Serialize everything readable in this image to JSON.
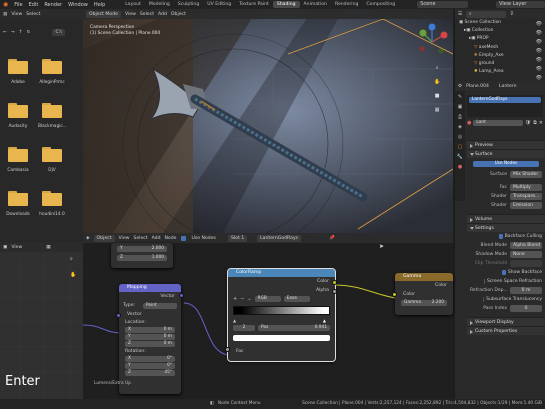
{
  "topbar": {
    "menus": [
      "File",
      "Edit",
      "Render",
      "Window",
      "Help"
    ],
    "workspaces": [
      "Layout",
      "Modeling",
      "Sculpting",
      "UV Editing",
      "Texture Paint",
      "Shading",
      "Animation",
      "Rendering",
      "Compositing"
    ],
    "active_workspace": "Shading",
    "scene": "Scene",
    "view_layer": "View Layer"
  },
  "file_browser": {
    "header": [
      "View",
      "Select"
    ],
    "path": "C:\\",
    "folders": [
      "Adobe",
      "AlleginPrmc",
      "Audacity",
      "Blackmagic...",
      "Cambasia",
      "DjV",
      "Downloads",
      "houdini14.0"
    ]
  },
  "viewport": {
    "mode": "Object Mode",
    "menus": [
      "View",
      "Select",
      "Add",
      "Object"
    ],
    "orientation_label": "Orientation:",
    "orientation": "Default",
    "drag_label": "Drag",
    "select_box": "Select Box",
    "transform": "Local",
    "overlay_title": "Camera Perspective",
    "overlay_sub": "(1) Scene Collection | Plane.004"
  },
  "outliner": {
    "title": "Scene Collection",
    "rows": [
      "Collection",
      "PROP",
      "axeMesh",
      "Empty_Axe",
      "ground",
      "Lamp_Area"
    ]
  },
  "properties": {
    "object_name": "Plane.004",
    "tab2": "Lantern",
    "material_slot": "LanternGodRays",
    "material_name": "Lant",
    "sections": {
      "preview": "Preview",
      "surface": "Surface",
      "volume": "Volume",
      "settings": "Settings",
      "viewport_display": "Viewport Display",
      "custom_properties": "Custom Properties"
    },
    "use_nodes": "Use Nodes",
    "surface_rows": [
      {
        "k": "Surface",
        "v": "Mix Shader"
      },
      {
        "k": "Fac",
        "v": "Multiply"
      },
      {
        "k": "Shader",
        "v": "Transpare..."
      },
      {
        "k": "Shader",
        "v": "Emission"
      }
    ],
    "settings_rows": [
      {
        "k": "",
        "v": "Backface Culling",
        "check": true
      },
      {
        "k": "Blend Mode",
        "v": "Alpha Blend"
      },
      {
        "k": "Shadow Mode",
        "v": "None"
      },
      {
        "k": "Clip Threshold",
        "v": ""
      },
      {
        "k": "",
        "v": "Show Backface",
        "check": true
      },
      {
        "k": "",
        "v": "Screen Space Refraction",
        "check": false
      },
      {
        "k": "Refraction Dep...",
        "v": "0 m"
      },
      {
        "k": "",
        "v": "Subsurface Translucency",
        "check": false
      },
      {
        "k": "Pass Index",
        "v": "0"
      }
    ]
  },
  "node_editor": {
    "object": "Object",
    "menus": [
      "View",
      "Select",
      "Add",
      "Node"
    ],
    "use_nodes": "Use Nodes",
    "slot": "Slot 1",
    "material": "LanternGodRays",
    "top_fields": [
      {
        "k": "Y",
        "v": "2.000"
      },
      {
        "k": "Z",
        "v": "1.000"
      }
    ],
    "mapping": {
      "title": "Mapping",
      "out": "Vector",
      "type_label": "Type:",
      "type": "Point",
      "in": "Vector",
      "location_label": "Location:",
      "location": [
        {
          "k": "X",
          "v": "0 m"
        },
        {
          "k": "Y",
          "v": "0 m"
        },
        {
          "k": "Z",
          "v": "0 m"
        }
      ],
      "rotation_label": "Rotation:",
      "rotation": [
        {
          "k": "X",
          "v": "0°"
        },
        {
          "k": "Y",
          "v": "0°"
        },
        {
          "k": "Z",
          "v": "45°"
        }
      ]
    },
    "colorramp": {
      "title": "ColorRamp",
      "out_color": "Color",
      "out_alpha": "Alpha",
      "mode": "RGB",
      "interp": "Ease",
      "stop": "2",
      "pos_label": "Pos",
      "pos": "0.941",
      "in": "Fac"
    },
    "gamma": {
      "title": "Gamma",
      "out": "Color",
      "in": "Color",
      "gamma_label": "Gamma",
      "gamma": "2.200"
    },
    "offset_label": "Lumens/Extra Up"
  },
  "left_bottom": {
    "view": "View"
  },
  "status": {
    "left": "Enter",
    "mid": "Node Context Menu",
    "stats": "Scene Collection | Plane.004 | Verts:2,257,124 | Faces:2,252,892 | Tris:4,504,832 | Objects:1/29 | Mem:1.40 GiB"
  }
}
